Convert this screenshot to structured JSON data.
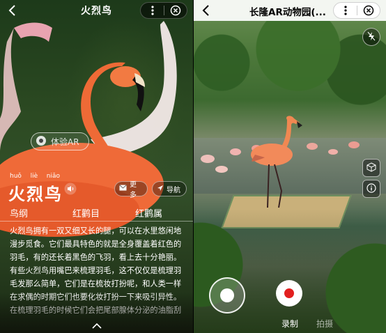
{
  "left": {
    "title": "火烈鸟",
    "ar_button_label": "体验AR",
    "pinyin": [
      "huǒ",
      "liè",
      "niǎo"
    ],
    "name": "火烈鸟",
    "more_label": "更多",
    "nav_label": "导航",
    "taxonomy": [
      "鸟纲",
      "红鹳目",
      "红鹳属"
    ],
    "description": "火烈鸟拥有一双又细又长的腿，可以在水里悠闲地漫步觅食。它们最具特色的就是全身覆盖着红色的羽毛，有的还长着黑色的飞羽，看上去十分艳丽。有些火烈鸟用嘴巴来梳理羽毛，这不仅仅是梳理羽毛发那么简单，它们是在梳妆打扮呢，和人类一样在求偶的时期它们也要化妆打扮一下来吸引异性。在梳理羽毛的时候它们会把尾部腺体分泌的油脂刮下来，涂抹到羽毛上，这样不仅仅"
  },
  "right": {
    "title": "长隆AR动物园(...",
    "mode_record": "录制",
    "mode_photo": "拍摄"
  },
  "colors": {
    "record_red": "#e21f1f",
    "topbar_light": "#ffffff"
  },
  "icons": {
    "back": "back-chevron-icon",
    "more": "more-dots-icon",
    "close": "close-circle-icon",
    "ar": "ar-icon",
    "speaker": "speaker-icon",
    "more_pill": "envelope-icon",
    "nav_pill": "navigation-arrow-icon",
    "flash": "flash-icon",
    "cube": "cube-icon",
    "info": "info-icon"
  }
}
